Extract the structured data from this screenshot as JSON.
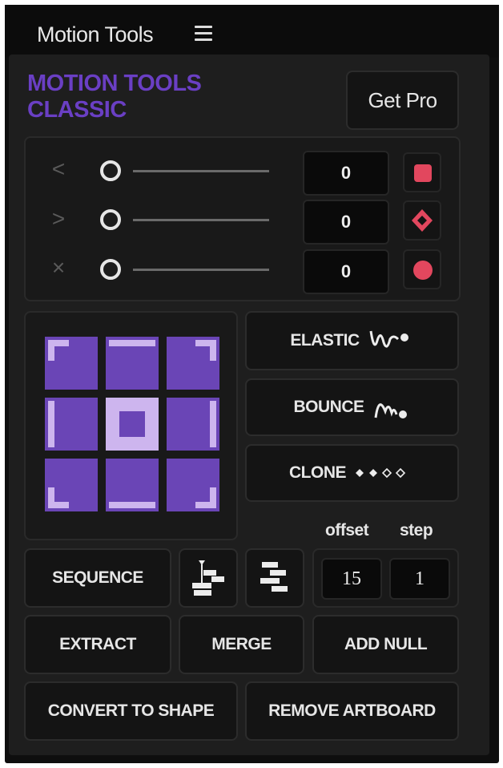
{
  "tab": {
    "title": "Motion Tools"
  },
  "brand": {
    "line1": "MOTION TOOLS",
    "line2": "CLASSIC"
  },
  "get_pro": {
    "label": "Get Pro"
  },
  "sliders": [
    {
      "icon": "<",
      "icon_name": "ease-in-icon",
      "value": "0",
      "key_color": "#e2475e"
    },
    {
      "icon": ">",
      "icon_name": "ease-out-icon",
      "value": "0",
      "key_color": "#e2475e"
    },
    {
      "icon": "×",
      "icon_name": "close-icon",
      "value": "0",
      "key_color": "#e2475e"
    }
  ],
  "anchor": {
    "cell_color": "#6a45b6",
    "mark_color": "#cdb5ee"
  },
  "effects": {
    "elastic": "ELASTIC",
    "bounce": "BOUNCE",
    "clone": "CLONE"
  },
  "sequence": {
    "label": "SEQUENCE",
    "offset_label": "offset",
    "step_label": "step",
    "offset_value": "15",
    "step_value": "1"
  },
  "actions": {
    "extract": "EXTRACT",
    "merge": "MERGE",
    "add_null": "ADD NULL",
    "convert_to_shape": "CONVERT TO SHAPE",
    "remove_artboard": "REMOVE ARTBOARD"
  },
  "colors": {
    "brand": "#6a3fc4",
    "accent_red": "#e2475e",
    "panel_bg": "#1e1e1e"
  }
}
